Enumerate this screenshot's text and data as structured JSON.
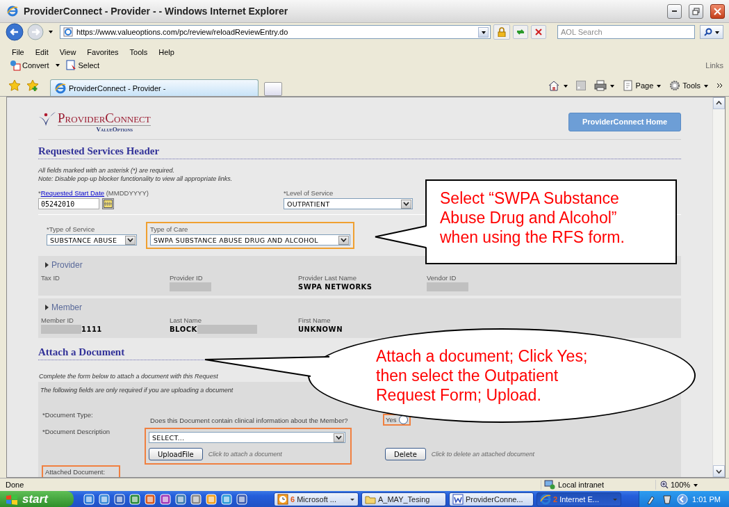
{
  "window": {
    "title": "ProviderConnect - Provider - - Windows Internet Explorer"
  },
  "address_bar": {
    "url": "https://www.valueoptions.com/pc/review/reloadReviewEntry.do"
  },
  "search": {
    "placeholder": "AOL Search"
  },
  "menu": [
    "File",
    "Edit",
    "View",
    "Favorites",
    "Tools",
    "Help"
  ],
  "toolbar": {
    "items": [
      {
        "label": "Convert",
        "kind": "convert"
      },
      {
        "label": "Select",
        "kind": "select"
      }
    ],
    "links": "Links"
  },
  "tabs": [
    {
      "label": "ProviderConnect - Provider -",
      "selected": true
    }
  ],
  "command_bar": [
    {
      "label": "Page",
      "kind": "page"
    },
    {
      "label": "Tools",
      "kind": "tools"
    }
  ],
  "page": {
    "logo": {
      "name": "ProviderConnect",
      "company": "ValueOptions"
    },
    "home_button": "ProviderConnect Home",
    "header": {
      "title": "Requested Services Header",
      "notes": [
        "All fields marked with an asterisk (*) are required.",
        "Note: Disable pop-up blocker functionality to view all appropriate links."
      ]
    },
    "start_date": {
      "required": "*",
      "label": "Requested Start Date",
      "hint": "(MMDDYYYY)",
      "value": "05242010"
    },
    "level_of_service": {
      "label": "*Level of Service",
      "value": "OUTPATIENT"
    },
    "type_of_service": {
      "label": "*Type of Service",
      "value": "SUBSTANCE ABUSE"
    },
    "type_of_care": {
      "label": "Type of Care",
      "value": "SWPA SUBSTANCE ABUSE DRUG AND ALCOHOL",
      "highlighted": true
    },
    "panels": [
      {
        "title": "Provider",
        "fields": [
          {
            "label": "Tax ID"
          },
          {
            "label": "Provider ID",
            "redacted_before": true
          },
          {
            "label": "Provider Last Name",
            "value": "SWPA NETWORKS"
          },
          {
            "label": "Vendor ID",
            "redacted_before": true
          }
        ]
      },
      {
        "title": "Member",
        "fields": [
          {
            "label": "Member ID",
            "value": "1111",
            "redacted_before": true
          },
          {
            "label": "Last Name",
            "value": "BLOCK",
            "redacted_after": true
          },
          {
            "label": "First Name",
            "value": "UNKNOWN"
          }
        ]
      }
    ],
    "attach": {
      "title": "Attach a Document",
      "intro": "Complete the form below to attach a document with this Request",
      "note": "The following fields are only required if you are uploading a document",
      "document_type": {
        "label": "*Document Type:",
        "question": "Does this Document contain clinical information about the Member?",
        "options": [
          {
            "label": "Yes",
            "selected": false,
            "highlighted": true
          }
        ]
      },
      "document_description": {
        "label": "*Document Description",
        "value": "SELECT...",
        "highlighted": true
      },
      "upload": {
        "button": "UploadFile",
        "hint": "Click to attach a document"
      },
      "delete": {
        "button": "Delete",
        "hint": "Click to delete an attached document"
      },
      "attached_document": {
        "label": "Attached Document:",
        "highlighted": true
      }
    }
  },
  "callouts": [
    {
      "kind": "rectangle",
      "text": "Select “SWPA Substance Abuse Drug and Alcohol” when using the RFS form."
    },
    {
      "kind": "ellipse",
      "text": "Attach a document; Click Yes; then select the Outpatient Request Form; Upload."
    }
  ],
  "status_bar": {
    "text": "Done",
    "zone": "Local intranet",
    "zoom": "100%"
  },
  "taskbar": {
    "start": "start",
    "tasks": [
      {
        "label": "Microsoft ...",
        "count": "6",
        "kind": "clock",
        "selected": false
      },
      {
        "label": "A_MAY_Tesing",
        "kind": "folder",
        "selected": false
      },
      {
        "label": "ProviderConne...",
        "kind": "word",
        "selected": false
      },
      {
        "label": "Internet E...",
        "count": "2",
        "kind": "ie",
        "selected": true
      }
    ],
    "clock": "1:01 PM"
  }
}
